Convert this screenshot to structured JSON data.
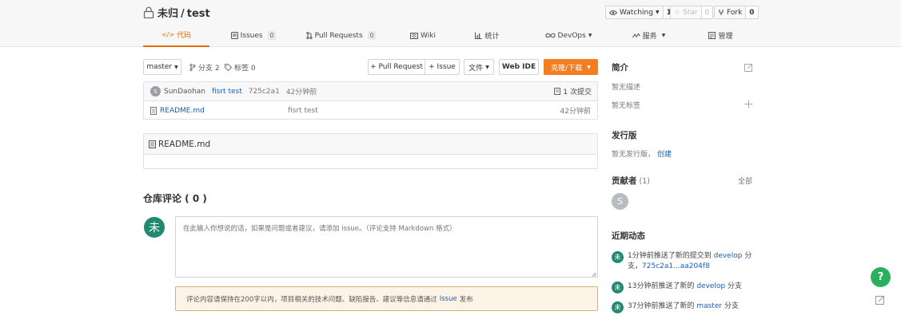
{
  "repo": {
    "owner": "未归",
    "separator": "/",
    "name": "test"
  },
  "stats": {
    "watch": {
      "label": "Watching",
      "count": "1"
    },
    "star": {
      "label": "Star",
      "count": "0"
    },
    "fork": {
      "label": "Fork",
      "count": "0"
    }
  },
  "tabs": [
    {
      "label": "代码",
      "icon": "code-icon",
      "active": true
    },
    {
      "label": "Issues",
      "badge": "0",
      "icon": "issue-icon"
    },
    {
      "label": "Pull Requests",
      "badge": "0",
      "icon": "pull-request-icon"
    },
    {
      "label": "Wiki",
      "icon": "wiki-icon"
    },
    {
      "label": "统计",
      "icon": "bar-chart-icon"
    },
    {
      "label": "DevOps",
      "icon": "infinity-icon"
    },
    {
      "label": "服务",
      "icon": "service-icon"
    },
    {
      "label": "管理",
      "icon": "manage-icon"
    }
  ],
  "toolbar": {
    "branch": "master",
    "branches": "分支 2",
    "tags": "标签 0",
    "pull_request": "+ Pull Request",
    "issue": "+ Issue",
    "file": "文件",
    "web_ide": "Web IDE",
    "clone": "克隆/下载"
  },
  "commit": {
    "avatar_letter": "S",
    "author": "SunDaohan",
    "message": "fisrt test",
    "sha": "725c2a1",
    "time": "42分钟前",
    "total": "1 次提交"
  },
  "files": [
    {
      "name": "README.md",
      "message": "fisrt test",
      "time": "42分钟前"
    }
  ],
  "readme": {
    "title": "README.md"
  },
  "comments": {
    "title": "仓库评论 ( 0 )",
    "avatar_letter": "未",
    "placeholder": "在此输入你想说的话，如果是问题或者建议，请添加 issue。（评论支持 Markdown 格式）",
    "notice_before": "评论内容请保持在200字以内，项目相关的技术问题、缺陷报告、建议等信息请通过",
    "notice_link": "Issue",
    "notice_after": "发布"
  },
  "sidebar": {
    "intro_title": "简介",
    "no_description": "暂无描述",
    "no_tags": "暂无标签",
    "releases_title": "发行版",
    "no_release": "暂无发行版，",
    "create_link": "创建",
    "contributors_title": "贡献者",
    "contributors_count": "(1)",
    "all_link": "全部",
    "contributor_letter": "S",
    "activity_title": "近期动态",
    "activities": [
      {
        "avatar": "未",
        "prefix": "1分钟前推送了新的提交到",
        "branch": "develop",
        "suffix": "分支，",
        "link": "725c2a1...aa204f8"
      },
      {
        "avatar": "未",
        "prefix": "13分钟前推送了新的",
        "branch": "develop",
        "suffix": "分支"
      },
      {
        "avatar": "未",
        "prefix": "37分钟前推送了新的",
        "branch": "master",
        "suffix": "分支"
      }
    ]
  },
  "float": {
    "help": "?"
  },
  "colors": {
    "accent": "#e46c0a",
    "clone_button": "#f37d1f",
    "link": "#1a5fb4",
    "avatar_green": "#1f8a70",
    "help_green": "#2bb05f"
  }
}
